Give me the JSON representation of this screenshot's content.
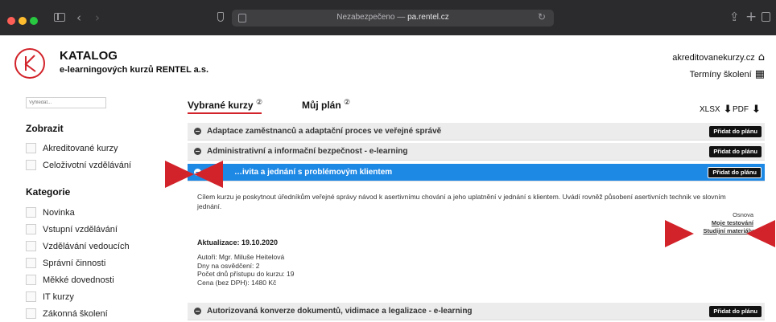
{
  "browser": {
    "url_prefix": "Nezabezpečeno — ",
    "url_domain": "pa.rentel.cz"
  },
  "header": {
    "title": "KATALOG",
    "subtitle": "e-learningových kurzů RENTEL a.s.",
    "link_accredited": "akreditovanekurzy.cz",
    "link_dates": "Termíny školení"
  },
  "sidebar": {
    "search_placeholder": "Vyhledat...",
    "show_title": "Zobrazit",
    "show_items": [
      "Akreditované kurzy",
      "Celoživotní vzdělávání"
    ],
    "category_title": "Kategorie",
    "categories": [
      "Novinka",
      "Vstupní vzdělávání",
      "Vzdělávání vedoucích",
      "Správní činnosti",
      "Měkké dovednosti",
      "IT kurzy",
      "Zákonná školení"
    ]
  },
  "main": {
    "tabs": [
      {
        "label": "Vybrané kurzy",
        "mark": "②"
      },
      {
        "label": "Můj plán",
        "mark": "②"
      }
    ],
    "export_xlsx": "XLSX",
    "export_pdf": "PDF",
    "add_label": "Přidat do plánu",
    "courses": [
      "Adaptace zaměstnanců a adaptační proces ve veřejné správě",
      "Administrativní a informační bezpečnost - e-learning",
      "…ivita a jednání s problémovým klientem",
      "Autorizovaná konverze dokumentů, vidimace a legalizace - e-learning"
    ],
    "detail": {
      "description": "Cílem kurzu je poskytnout úředníkům veřejné správy návod k asertivnímu chování a jeho uplatnění v jednání s klientem. Uvádí rovněž působení asertivních technik ve slovním jednání.",
      "outline": "Osnova",
      "my_testing": "Moje testování",
      "study_materials": "Studijní materiály",
      "updated": "Aktualizace: 19.10.2020",
      "authors": "Autoři: Mgr. Miluše Heitelová",
      "days": "Dny na osvědčení: 2",
      "access": "Počet dnů přístupu do kurzu: 19",
      "price": "Cena (bez DPH): 1480 Kč"
    }
  },
  "colors": {
    "accent_red": "#d2232a",
    "active_blue": "#1e88e5"
  }
}
